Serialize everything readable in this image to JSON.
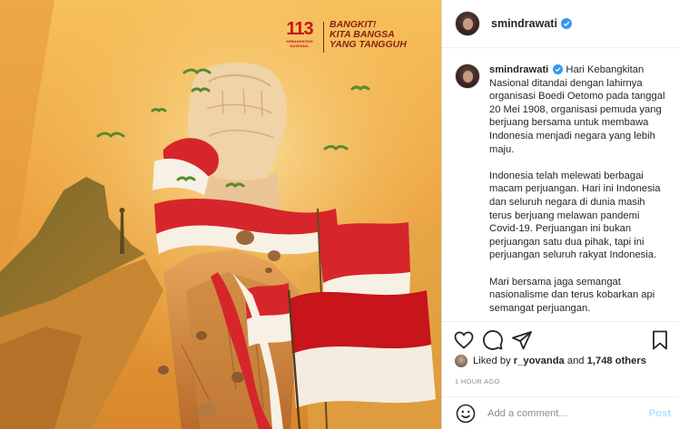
{
  "post": {
    "username": "smindrawati",
    "verified": true,
    "image": {
      "logo_number": "113",
      "logo_subtitle": "KEBANGKITAN NASIONAL",
      "slogan_line1": "BANGKIT!",
      "slogan_line2": "KITA BANGSA",
      "slogan_line3": "YANG TANGGUH"
    },
    "caption": {
      "username": "smindrawati",
      "paragraph1": "Hari Kebangkitan Nasional ditandai dengan lahirnya organisasi Boedi Oetomo pada tanggal 20 Mei 1908, organisasi pemuda yang berjuang bersama untuk membawa Indonesia menjadi negara yang lebih maju.",
      "paragraph2": "Indonesia telah melewati berbagai macam perjuangan. Hari ini Indonesia dan seluruh negara di dunia masih terus berjuang melawan pandemi Covid-19. Perjuangan ini bukan perjuangan satu dua pihak, tapi ini perjuangan seluruh rakyat Indonesia.",
      "paragraph3": "Mari bersama jaga semangat nasionalisme dan terus kobarkan api semangat perjuangan."
    },
    "actions": {
      "like": "heart-icon",
      "comment": "comment-icon",
      "share": "share-icon",
      "save": "bookmark-icon"
    },
    "likes": {
      "prefix": "Liked by",
      "user": "r_yovanda",
      "middle": "and",
      "count": "1,748 others"
    },
    "timestamp": "1 HOUR AGO",
    "comment_placeholder": "Add a comment...",
    "post_button": "Post"
  },
  "colors": {
    "verified": "#3897f0",
    "flag_red": "#c8141b",
    "post_button": "#b2dffc"
  }
}
